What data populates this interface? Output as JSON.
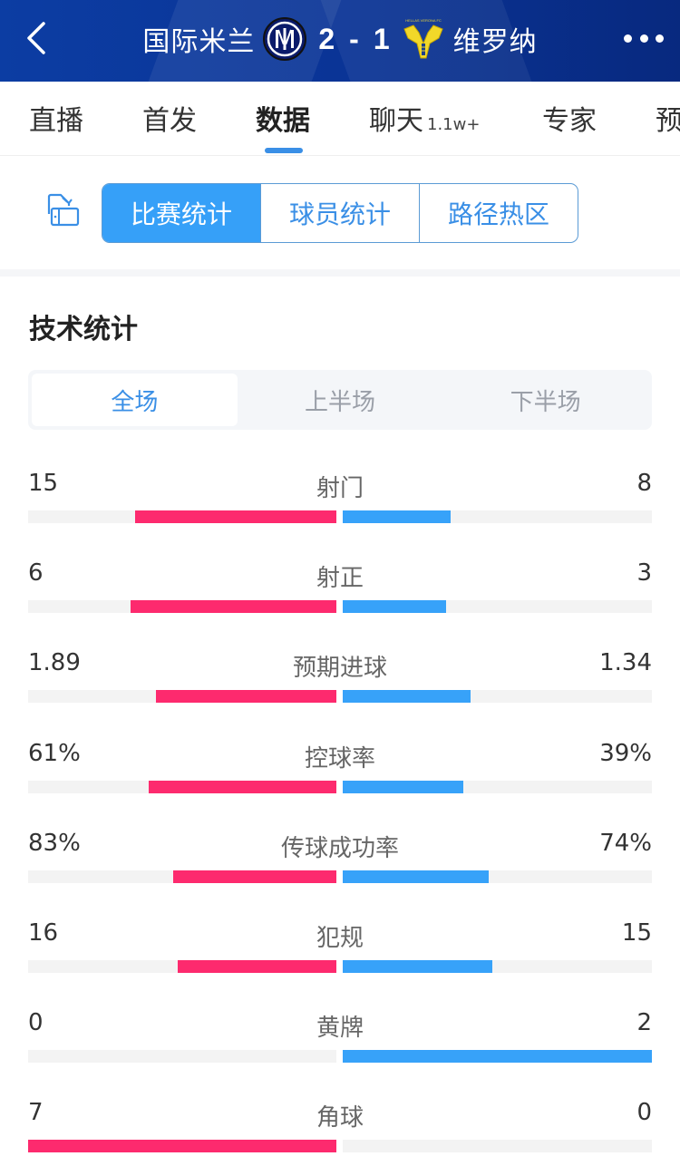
{
  "header": {
    "home_team": "国际米兰",
    "away_team": "维罗纳",
    "home_score": "2",
    "away_score": "1",
    "score_separator": "-",
    "home_logo_icon": "inter-milan-logo",
    "away_logo_icon": "hellas-verona-logo",
    "away_logo_caption": "HELLAS VERONA FC",
    "back_icon": "chevron-left-icon",
    "more_icon": "more-dots-icon"
  },
  "nav": {
    "tabs": [
      {
        "label": "直播",
        "active": false
      },
      {
        "label": "首发",
        "active": false
      },
      {
        "label": "数据",
        "active": true
      },
      {
        "label": "聊天",
        "badge": "1.1w+",
        "active": false
      },
      {
        "label": "专家",
        "active": false
      },
      {
        "label": "预测",
        "active": false
      }
    ]
  },
  "sub_tabs": {
    "rotate_icon": "screen-rotate-icon",
    "items": [
      {
        "label": "比赛统计",
        "active": true
      },
      {
        "label": "球员统计",
        "active": false
      },
      {
        "label": "路径热区",
        "active": false
      }
    ]
  },
  "section": {
    "title": "技术统计",
    "periods": [
      {
        "label": "全场",
        "active": true
      },
      {
        "label": "上半场",
        "active": false
      },
      {
        "label": "下半场",
        "active": false
      }
    ]
  },
  "colors": {
    "home": "#fd2a6e",
    "away": "#37a2f9",
    "accent": "#36a0f8"
  },
  "stats": [
    {
      "label": "射门",
      "home": "15",
      "away": "8",
      "home_val": 15,
      "away_val": 8
    },
    {
      "label": "射正",
      "home": "6",
      "away": "3",
      "home_val": 6,
      "away_val": 3
    },
    {
      "label": "预期进球",
      "home": "1.89",
      "away": "1.34",
      "home_val": 1.89,
      "away_val": 1.34
    },
    {
      "label": "控球率",
      "home": "61%",
      "away": "39%",
      "home_val": 61,
      "away_val": 39
    },
    {
      "label": "传球成功率",
      "home": "83%",
      "away": "74%",
      "home_val": 83,
      "away_val": 74
    },
    {
      "label": "犯规",
      "home": "16",
      "away": "15",
      "home_val": 16,
      "away_val": 15
    },
    {
      "label": "黄牌",
      "home": "0",
      "away": "2",
      "home_val": 0,
      "away_val": 2
    },
    {
      "label": "角球",
      "home": "7",
      "away": "0",
      "home_val": 7,
      "away_val": 0
    }
  ]
}
